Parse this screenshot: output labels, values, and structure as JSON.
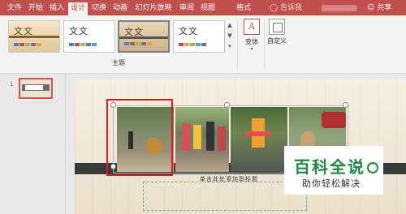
{
  "tabs": [
    {
      "label": "文件",
      "active": false
    },
    {
      "label": "开始",
      "active": false
    },
    {
      "label": "插入",
      "active": false
    },
    {
      "label": "设计",
      "active": true
    },
    {
      "label": "切换",
      "active": false
    },
    {
      "label": "动画",
      "active": false
    },
    {
      "label": "幻灯片放映",
      "active": false
    },
    {
      "label": "审阅",
      "active": false
    },
    {
      "label": "视图",
      "active": false
    },
    {
      "label": "格式",
      "active": false
    }
  ],
  "tell_me": "告诉我",
  "share": "共享",
  "themes": [
    {
      "sample": "文文"
    },
    {
      "sample": "文文"
    },
    {
      "sample": "文文"
    },
    {
      "sample": "文文"
    }
  ],
  "theme_group_label": "主题",
  "variant_label": "变体",
  "customize_label": "自定义",
  "slide_number": "1",
  "caption": "单击此处添加副标题",
  "watermark": {
    "title": "百科全说",
    "subtitle": "助你轻松解决"
  },
  "colors": {
    "accent": "#c0504d",
    "selection": "#e01b1b",
    "watermark": "#1a8a41"
  }
}
